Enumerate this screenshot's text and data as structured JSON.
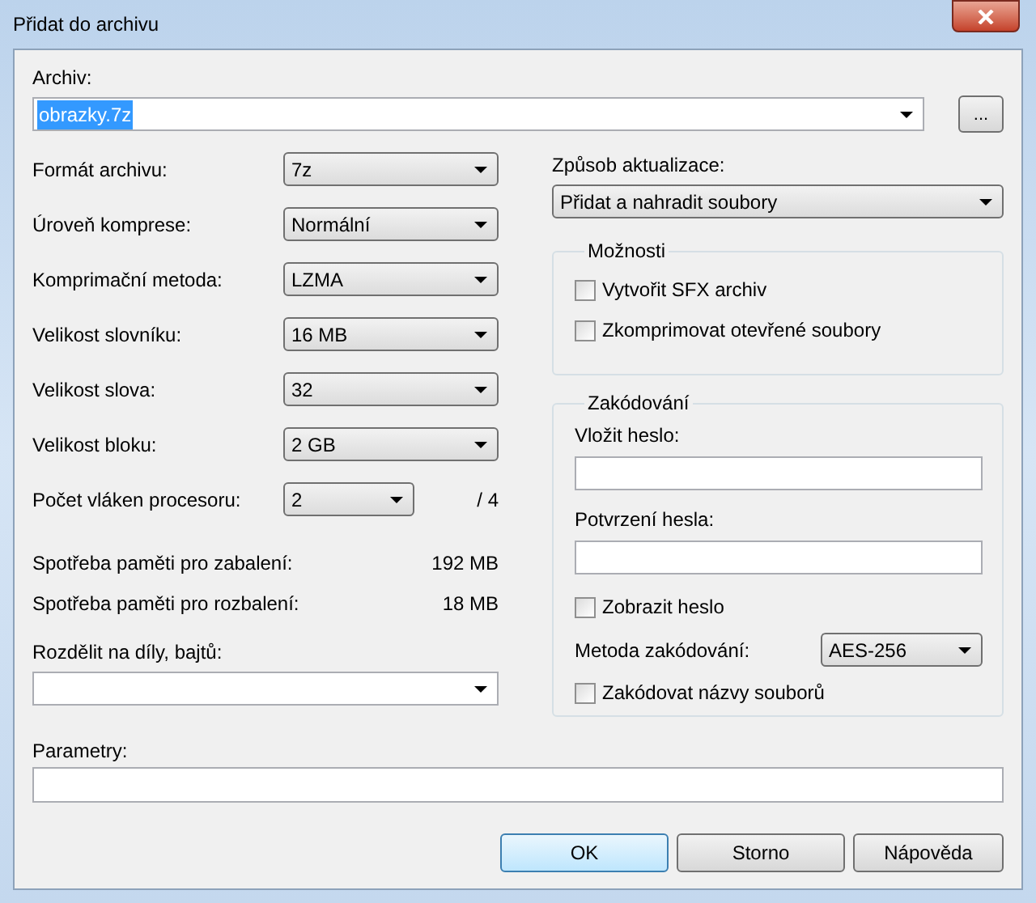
{
  "window": {
    "title": "Přidat do archivu"
  },
  "archive": {
    "label": "Archiv:",
    "value": "obrazky.7z",
    "selected": true,
    "browse": "..."
  },
  "settings": [
    {
      "label": "Formát archivu:",
      "value": "7z"
    },
    {
      "label": "Úroveň komprese:",
      "value": "Normální"
    },
    {
      "label": "Komprimační metoda:",
      "value": "LZMA"
    },
    {
      "label": "Velikost slovníku:",
      "value": "16 MB"
    },
    {
      "label": "Velikost slova:",
      "value": "32"
    },
    {
      "label": "Velikost bloku:",
      "value": "2 GB"
    }
  ],
  "threads": {
    "label": "Počet vláken procesoru:",
    "value": "2",
    "total": "/ 4"
  },
  "memory": [
    {
      "label": "Spotřeba paměti pro zabalení:",
      "value": "192 MB"
    },
    {
      "label": "Spotřeba paměti pro rozbalení:",
      "value": "18 MB"
    }
  ],
  "split": {
    "label": "Rozdělit na díly, bajtů:"
  },
  "parameters": {
    "label": "Parametry:"
  },
  "update": {
    "label": "Způsob aktualizace:",
    "value": "Přidat a nahradit soubory"
  },
  "options": {
    "title": "Možnosti",
    "items": [
      {
        "label": "Vytvořit SFX archiv",
        "checked": false
      },
      {
        "label": "Zkomprimovat otevřené soubory",
        "checked": false
      }
    ]
  },
  "encryption": {
    "title": "Zakódování",
    "password_label": "Vložit heslo:",
    "confirm_label": "Potvrzení hesla:",
    "show_password": {
      "label": "Zobrazit heslo",
      "checked": false
    },
    "method": {
      "label": "Metoda zakódování:",
      "value": "AES-256"
    },
    "encrypt_names": {
      "label": "Zakódovat názvy souborů",
      "checked": false
    }
  },
  "buttons": [
    {
      "label": "OK",
      "default": true
    },
    {
      "label": "Storno",
      "default": false
    },
    {
      "label": "Nápověda",
      "default": false
    }
  ]
}
